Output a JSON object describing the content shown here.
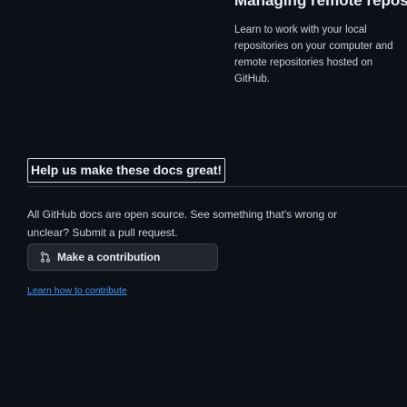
{
  "previous_card": {
    "heading": "Managing remote repositories",
    "text": "Learn to work with your local repositories on your computer and remote repositories hosted on GitHub."
  },
  "contribute": {
    "title": "Help us make these docs great!",
    "body": "All GitHub docs are open source. See something that's wrong or unclear? Submit a pull request.",
    "button_label": "Make a contribution",
    "button_icon": "git-pull-request-icon",
    "learn_link": "Learn how to contribute"
  },
  "colors": {
    "background": "#0d1117",
    "link": "#4493f8",
    "heading": "#e6edf3"
  }
}
